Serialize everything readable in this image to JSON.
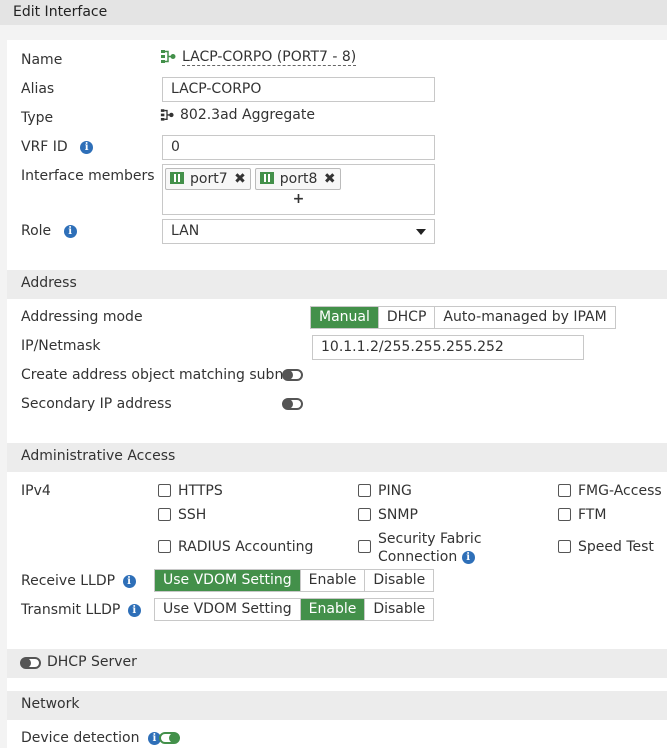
{
  "window": {
    "title": "Edit Interface"
  },
  "fields": {
    "name_label": "Name",
    "name_value": "LACP-CORPO (PORT7 - 8)",
    "alias_label": "Alias",
    "alias_value": "LACP-CORPO",
    "type_label": "Type",
    "type_value": "802.3ad Aggregate",
    "vrf_label": "VRF ID",
    "vrf_value": "0",
    "members_label": "Interface members",
    "members": [
      "port7",
      "port8"
    ],
    "add_member": "+",
    "role_label": "Role",
    "role_value": "LAN"
  },
  "address": {
    "section_title": "Address",
    "mode_label": "Addressing mode",
    "modes": [
      "Manual",
      "DHCP",
      "Auto-managed by IPAM"
    ],
    "mode_selected": "Manual",
    "ip_label": "IP/Netmask",
    "ip_value": "10.1.1.2/255.255.255.252",
    "create_obj_label": "Create address object matching subnet",
    "create_obj_enabled": false,
    "secondary_label": "Secondary IP address",
    "secondary_enabled": false
  },
  "admin": {
    "section_title": "Administrative Access",
    "ipv4_label": "IPv4",
    "options": {
      "https": "HTTPS",
      "ping": "PING",
      "fmg": "FMG-Access",
      "ssh": "SSH",
      "snmp": "SNMP",
      "ftm": "FTM",
      "radius": "RADIUS Accounting",
      "fabric_line1": "Security Fabric",
      "fabric_line2": "Connection",
      "speed": "Speed Test"
    },
    "receive_lldp_label": "Receive LLDP",
    "transmit_lldp_label": "Transmit LLDP",
    "lldp_options": [
      "Use VDOM Setting",
      "Enable",
      "Disable"
    ],
    "receive_lldp_selected": "Use VDOM Setting",
    "transmit_lldp_selected": "Enable"
  },
  "dhcp": {
    "label": "DHCP Server",
    "enabled": false
  },
  "network": {
    "section_title": "Network",
    "device_detection_label": "Device detection",
    "device_detection_enabled": true
  },
  "colors": {
    "accent": "#43904a",
    "info": "#2e6fb8"
  }
}
